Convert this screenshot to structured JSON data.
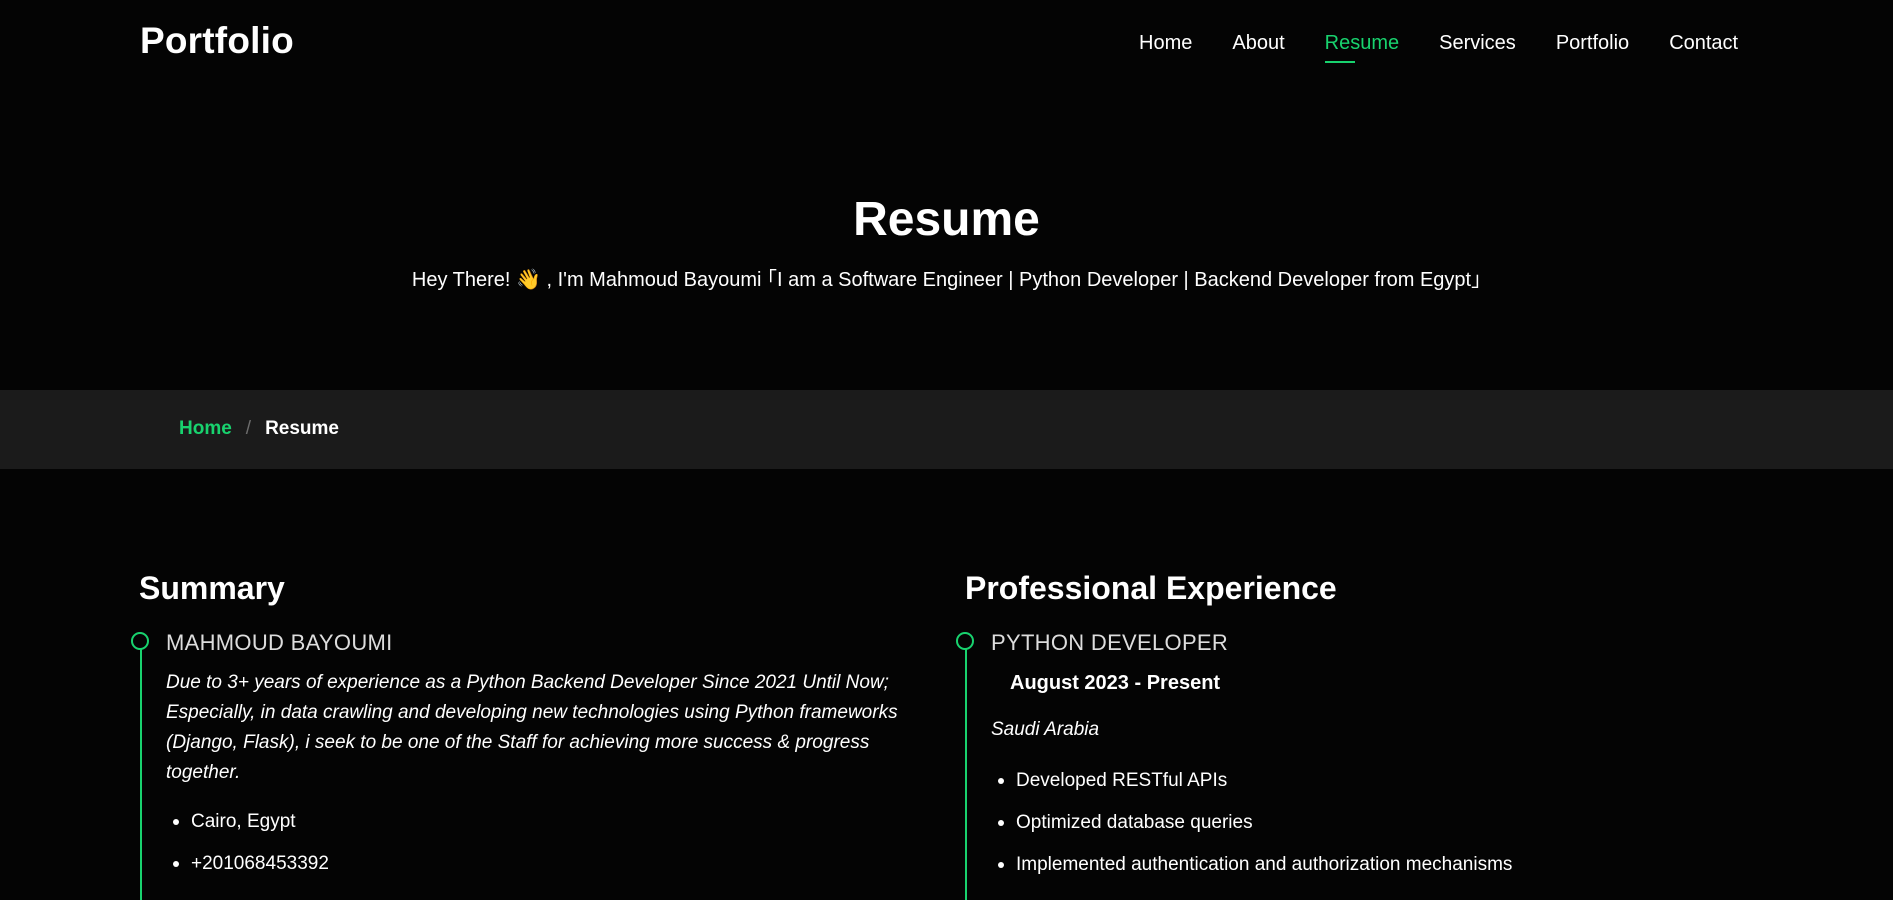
{
  "header": {
    "logo": "Portfolio",
    "nav": [
      {
        "label": "Home",
        "active": false
      },
      {
        "label": "About",
        "active": false
      },
      {
        "label": "Resume",
        "active": true
      },
      {
        "label": "Services",
        "active": false
      },
      {
        "label": "Portfolio",
        "active": false
      },
      {
        "label": "Contact",
        "active": false
      }
    ]
  },
  "hero": {
    "title": "Resume",
    "subtitle": "Hey There! 👋 , I'm Mahmoud Bayoumi ｢I am a Software Engineer | Python Developer | Backend Developer from Egypt｣"
  },
  "breadcrumb": {
    "home": "Home",
    "separator": "/",
    "current": "Resume"
  },
  "summary": {
    "heading": "Summary",
    "name": "MAHMOUD BAYOUMI",
    "text": "Due to 3+ years of experience as a Python Backend Developer Since 2021 Until Now; Especially, in data crawling and developing new technologies using Python frameworks (Django, Flask), i seek to be one of the Staff for achieving more success & progress together.",
    "details": [
      "Cairo, Egypt",
      "+201068453392"
    ]
  },
  "experience": {
    "heading": "Professional Experience",
    "job_title": "PYTHON DEVELOPER",
    "date": "August 2023 - Present",
    "location": "Saudi Arabia",
    "duties": [
      "Developed RESTful APIs",
      "Optimized database queries",
      "Implemented authentication and authorization mechanisms"
    ]
  },
  "colors": {
    "accent": "#18d26e",
    "background": "#040404",
    "breadcrumb_bg": "#1b1b1b"
  }
}
